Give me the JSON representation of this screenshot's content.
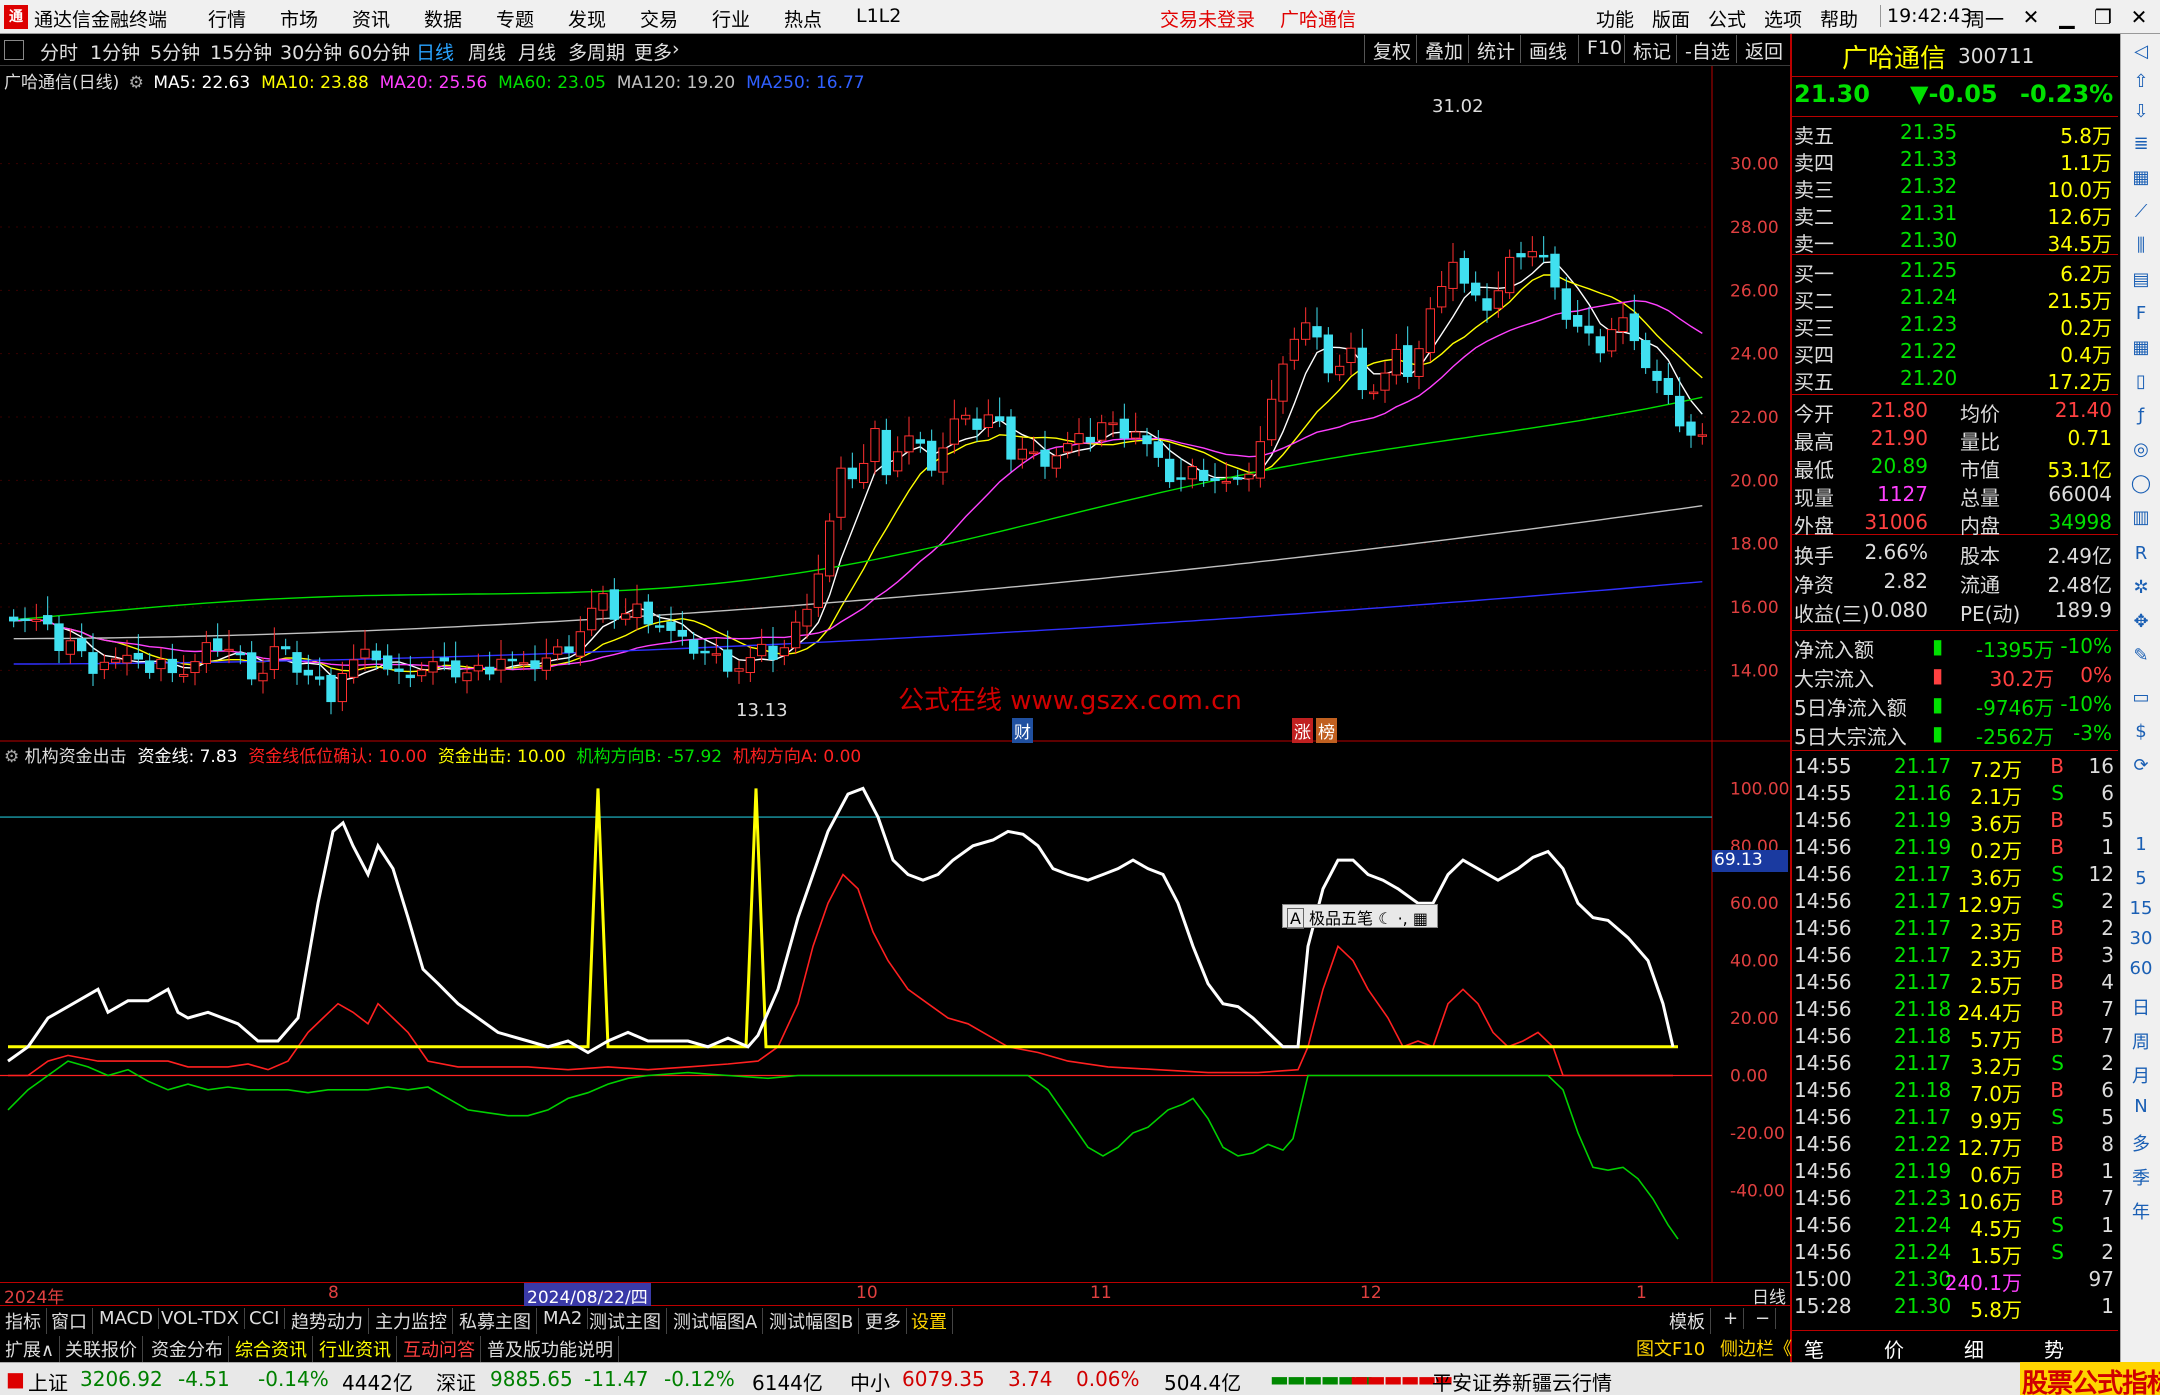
{
  "menubar": {
    "app_title": "通达信金融终端",
    "menus": [
      "行情",
      "市场",
      "资讯",
      "数据",
      "专题",
      "发现",
      "交易",
      "行业",
      "热点",
      "L1L2"
    ],
    "login": "交易未登录",
    "stock_title": "广哈通信",
    "right_menus": [
      "功能",
      "版面",
      "公式",
      "选项",
      "帮助"
    ],
    "time": "19:42:43",
    "weekday": "周一"
  },
  "toolbar": {
    "periods": [
      "分时",
      "1分钟",
      "5分钟",
      "15分钟",
      "30分钟",
      "60分钟",
      "日线",
      "周线",
      "月线",
      "多周期",
      "更多"
    ],
    "active": "日线",
    "right": [
      "复权",
      "叠加",
      "统计",
      "画线",
      "F10",
      "标记",
      "-自选",
      "返回"
    ]
  },
  "main_chart": {
    "title": "广哈通信(日线)",
    "ma": [
      {
        "label": "MA5: 22.63",
        "color": "#ffffff"
      },
      {
        "label": "MA10: 23.88",
        "color": "#ffff00"
      },
      {
        "label": "MA20: 25.56",
        "color": "#ff40ff"
      },
      {
        "label": "MA60: 23.05",
        "color": "#00e000"
      },
      {
        "label": "MA120: 19.20",
        "color": "#c0c0c0"
      },
      {
        "label": "MA250: 16.77",
        "color": "#3030ff"
      }
    ],
    "price_ticks": [
      "30.00",
      "28.00",
      "26.00",
      "24.00",
      "22.00",
      "20.00",
      "18.00",
      "16.00",
      "14.00"
    ],
    "max_label": "31.02",
    "min_label": "13.13",
    "watermark": "公式在线 www.gszx.com.cn",
    "markers": [
      "财",
      "涨",
      "榜"
    ]
  },
  "indicator": {
    "name": "机构资金出击",
    "params": [
      {
        "label": "资金线: 7.83",
        "color": "#ffffff"
      },
      {
        "label": "资金线低位确认: 10.00",
        "color": "#ff2020"
      },
      {
        "label": "资金出击: 10.00",
        "color": "#ffff00"
      },
      {
        "label": "机构方向B: -57.92",
        "color": "#00e000"
      },
      {
        "label": "机构方向A: 0.00",
        "color": "#ff2020"
      }
    ],
    "ticks": [
      "100.00",
      "80.00",
      "60.00",
      "40.00",
      "20.00",
      "0.00",
      "-20.00",
      "-40.00"
    ],
    "cursor_value": "69.13",
    "popup": "极品五笔"
  },
  "xaxis": {
    "labels": [
      "2024年",
      "8",
      "2024/08/22/四",
      "10",
      "11",
      "12",
      "1"
    ],
    "period": "日线"
  },
  "tabs1": [
    "指标",
    "窗口",
    "MACD",
    "VOL-TDX",
    "CCI",
    "趋势动力",
    "主力监控",
    "私募主图",
    "MA2",
    "测试主图",
    "测试幅图A",
    "测试幅图B",
    "更多",
    "设置"
  ],
  "tabs1_active": "设置",
  "tabs2": [
    "扩展∧",
    "关联报价",
    "资金分布",
    "综合资讯",
    "行业资讯",
    "互动问答",
    "普及版功能说明"
  ],
  "tabs1_right": [
    "模板",
    "+",
    "−"
  ],
  "quote": {
    "name": "广哈通信",
    "code": "300711",
    "price": "21.30",
    "change": "▼-0.05",
    "pct": "-0.23%",
    "asks": [
      {
        "l": "卖五",
        "p": "21.35",
        "v": "5.8万"
      },
      {
        "l": "卖四",
        "p": "21.33",
        "v": "1.1万"
      },
      {
        "l": "卖三",
        "p": "21.32",
        "v": "10.0万"
      },
      {
        "l": "卖二",
        "p": "21.31",
        "v": "12.6万"
      },
      {
        "l": "卖一",
        "p": "21.30",
        "v": "34.5万"
      }
    ],
    "bids": [
      {
        "l": "买一",
        "p": "21.25",
        "v": "6.2万"
      },
      {
        "l": "买二",
        "p": "21.24",
        "v": "21.5万"
      },
      {
        "l": "买三",
        "p": "21.23",
        "v": "0.2万"
      },
      {
        "l": "买四",
        "p": "21.22",
        "v": "0.4万"
      },
      {
        "l": "买五",
        "p": "21.20",
        "v": "17.2万"
      }
    ],
    "stats": [
      {
        "a": "今开",
        "av": "21.80",
        "b": "均价",
        "bv": "21.40"
      },
      {
        "a": "最高",
        "av": "21.90",
        "b": "量比",
        "bv": "0.71"
      },
      {
        "a": "最低",
        "av": "20.89",
        "b": "市值",
        "bv": "53.1亿"
      },
      {
        "a": "现量",
        "av": "1127",
        "b": "总量",
        "bv": "66004"
      },
      {
        "a": "外盘",
        "av": "31006",
        "b": "内盘",
        "bv": "34998"
      }
    ],
    "stats2": [
      {
        "a": "换手",
        "av": "2.66%",
        "b": "股本",
        "bv": "2.49亿"
      },
      {
        "a": "净资",
        "av": "2.82",
        "b": "流通",
        "bv": "2.48亿"
      },
      {
        "a": "收益(三)",
        "av": "0.080",
        "b": "PE(动)",
        "bv": "189.9"
      }
    ],
    "flows": [
      {
        "l": "净流入额",
        "v": "-1395万",
        "p": "-10%"
      },
      {
        "l": "大宗流入",
        "v": "30.2万",
        "p": "0%"
      },
      {
        "l": "5日净流入额",
        "v": "-9746万",
        "p": "-10%"
      },
      {
        "l": "5日大宗流入",
        "v": "-2562万",
        "p": "-3%"
      }
    ],
    "ticks": [
      {
        "t": "14:55",
        "p": "21.17",
        "v": "7.2万",
        "s": "B",
        "n": "16"
      },
      {
        "t": "14:55",
        "p": "21.16",
        "v": "2.1万",
        "s": "S",
        "n": "6"
      },
      {
        "t": "14:56",
        "p": "21.19",
        "v": "3.6万",
        "s": "B",
        "n": "5"
      },
      {
        "t": "14:56",
        "p": "21.19",
        "v": "0.2万",
        "s": "B",
        "n": "1"
      },
      {
        "t": "14:56",
        "p": "21.17",
        "v": "3.6万",
        "s": "S",
        "n": "12"
      },
      {
        "t": "14:56",
        "p": "21.17",
        "v": "12.9万",
        "s": "S",
        "n": "2"
      },
      {
        "t": "14:56",
        "p": "21.17",
        "v": "2.3万",
        "s": "B",
        "n": "2"
      },
      {
        "t": "14:56",
        "p": "21.17",
        "v": "2.3万",
        "s": "B",
        "n": "3"
      },
      {
        "t": "14:56",
        "p": "21.17",
        "v": "2.5万",
        "s": "B",
        "n": "4"
      },
      {
        "t": "14:56",
        "p": "21.18",
        "v": "24.4万",
        "s": "B",
        "n": "7"
      },
      {
        "t": "14:56",
        "p": "21.18",
        "v": "5.7万",
        "s": "B",
        "n": "7"
      },
      {
        "t": "14:56",
        "p": "21.17",
        "v": "3.2万",
        "s": "S",
        "n": "2"
      },
      {
        "t": "14:56",
        "p": "21.18",
        "v": "7.0万",
        "s": "B",
        "n": "6"
      },
      {
        "t": "14:56",
        "p": "21.17",
        "v": "9.9万",
        "s": "S",
        "n": "5"
      },
      {
        "t": "14:56",
        "p": "21.22",
        "v": "12.7万",
        "s": "B",
        "n": "8"
      },
      {
        "t": "14:56",
        "p": "21.19",
        "v": "0.6万",
        "s": "B",
        "n": "1"
      },
      {
        "t": "14:56",
        "p": "21.23",
        "v": "10.6万",
        "s": "B",
        "n": "7"
      },
      {
        "t": "14:56",
        "p": "21.24",
        "v": "4.5万",
        "s": "S",
        "n": "1"
      },
      {
        "t": "14:56",
        "p": "21.24",
        "v": "1.5万",
        "s": "S",
        "n": "2"
      },
      {
        "t": "15:00",
        "p": "21.30",
        "v": "240.1万",
        "s": "",
        "n": "97"
      },
      {
        "t": "15:28",
        "p": "21.30",
        "v": "5.8万",
        "s": "",
        "n": "1"
      }
    ],
    "bottom_tabs": [
      "笔",
      "价",
      "细",
      "势"
    ]
  },
  "sidebar": [
    "日",
    "周",
    "月",
    "N",
    "多",
    "季",
    "年"
  ],
  "statusbar": {
    "sh": {
      "name": "上证",
      "v": "3206.92",
      "c": "-4.51",
      "p": "-0.14%",
      "amt": "4442亿"
    },
    "sz": {
      "name": "深证",
      "v": "9885.65",
      "c": "-11.47",
      "p": "-0.12%",
      "amt": "6144亿"
    },
    "zx": {
      "name": "中小",
      "v": "6079.35",
      "c": "3.74",
      "p": "0.06%",
      "amt": "504.4亿"
    },
    "broker": "平安证券新疆云行情",
    "f10": "图文F10",
    "side": "侧边栏《",
    "wm": "股票公式指标网"
  }
}
